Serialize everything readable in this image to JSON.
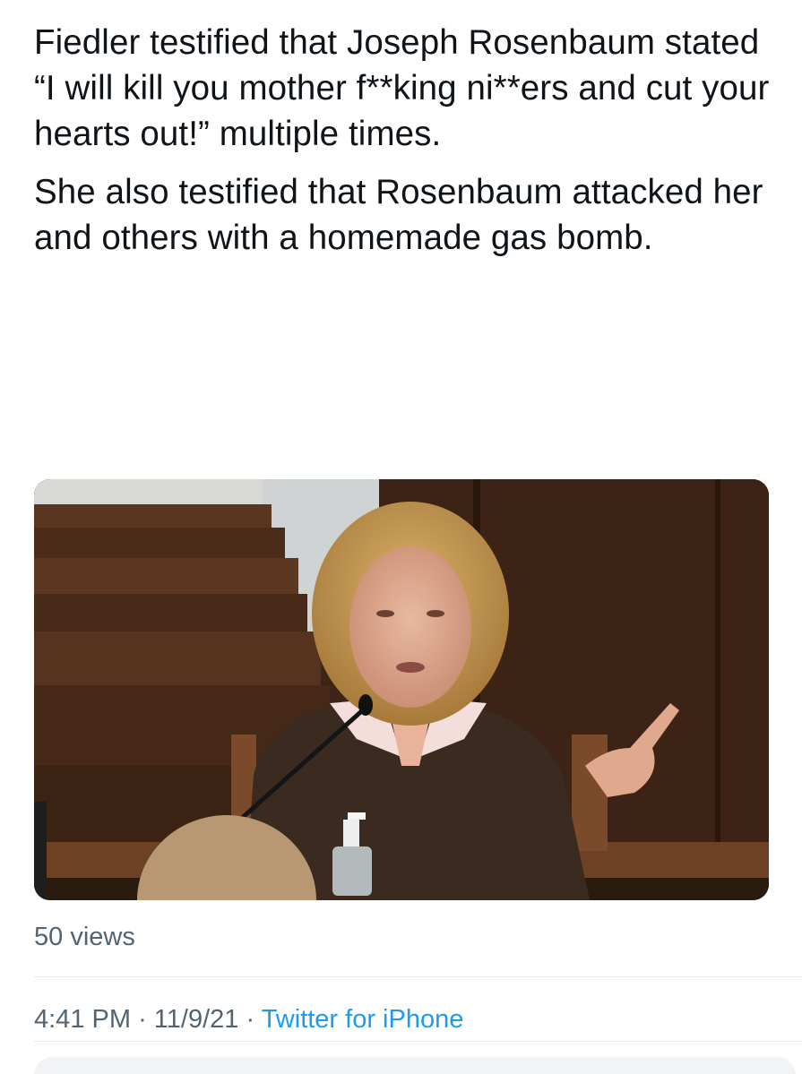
{
  "tweet": {
    "paragraphs": [
      "Fiedler testified that Joseph Rosenbaum stated “I will kill you mother f**king ni**ers and cut your hearts out!” multiple times.",
      "She also testified that Rosenbaum attacked her and others with a homemade gas bomb."
    ],
    "media": {
      "subject": "woman-testifying-on-witness-stand"
    },
    "views": "50 views",
    "time": "4:41 PM",
    "date": "11/9/21",
    "source": "Twitter for iPhone",
    "separator": "·"
  },
  "colors": {
    "text": "#0f1419",
    "secondary": "#536471",
    "link": "#1d9bf0"
  }
}
